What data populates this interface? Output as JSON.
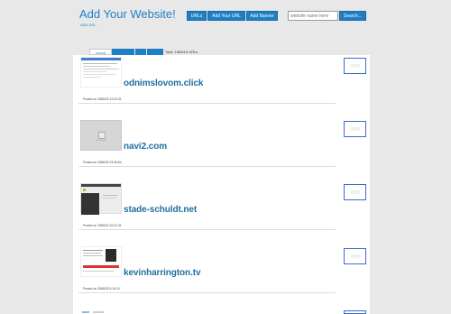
{
  "header": {
    "title": "Add Your Website!",
    "subtitle": "ADD URL"
  },
  "nav": {
    "urls": "URLs",
    "add_url": "Add Your URL",
    "add_banner": "Add Banner"
  },
  "search": {
    "placeholder": "website name here",
    "button": "Search..."
  },
  "tabs": [
    "recent",
    "",
    "",
    ""
  ],
  "total": "Total: 1858/19 URLs",
  "entries": [
    {
      "domain": "odnimslovom.click",
      "posted": "Posted on 2965/29 13:02:31"
    },
    {
      "domain": "navi2.com",
      "posted": "Posted on 2965/29 23:46:54"
    },
    {
      "domain": "stade-schuldt.net",
      "posted": "Posted on 2965/22 10:21:31"
    },
    {
      "domain": "kevinharrington.tv",
      "posted": "Posted on 2965/29 3:14:10"
    }
  ],
  "colors": {
    "accent": "#1f7fc4",
    "background": "#e8e8e8"
  }
}
